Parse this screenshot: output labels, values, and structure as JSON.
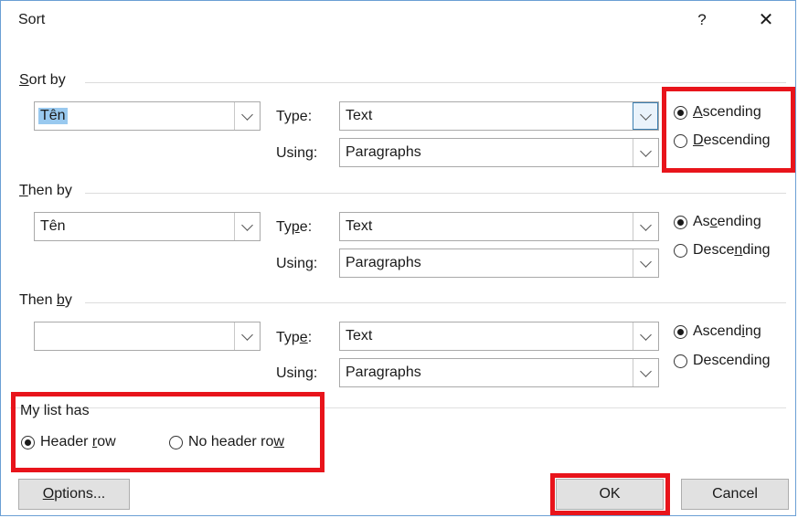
{
  "window": {
    "title": "Sort",
    "help": "?",
    "close": "✕"
  },
  "sort_by": {
    "label_pre": "",
    "label_u": "S",
    "label_post": "ort by",
    "field": "Tên",
    "type_label_pre": "Type:",
    "type": "Text",
    "using_label": "Using:",
    "using": "Paragraphs",
    "ascending_pre": "",
    "ascending_u": "A",
    "ascending_post": "scending",
    "descending_pre": "",
    "descending_u": "D",
    "descending_post": "escending"
  },
  "then_by_1": {
    "label_pre": "",
    "label_u": "T",
    "label_post": "hen by",
    "field": "Tên",
    "type_label_pre": "Ty",
    "type_label_u": "p",
    "type_label_post": "e:",
    "type": "Text",
    "using_label": "Using:",
    "using": "Paragraphs",
    "ascending_pre": "As",
    "ascending_u": "c",
    "ascending_post": "ending",
    "descending_pre": "Desce",
    "descending_u": "n",
    "descending_post": "ding"
  },
  "then_by_2": {
    "label_pre": "Then ",
    "label_u": "b",
    "label_post": "y",
    "field": "",
    "type_label_pre": "Typ",
    "type_label_u": "e",
    "type_label_post": ":",
    "type": "Text",
    "using_label": "Using:",
    "using": "Paragraphs",
    "ascending_pre": "Ascend",
    "ascending_u": "i",
    "ascending_post": "ng",
    "descending_pre": "Descendin",
    "descending_u": "g",
    "descending_post": ""
  },
  "my_list": {
    "label": "My list has",
    "header_pre": "Header ",
    "header_u": "r",
    "header_post": "ow",
    "noheader_pre": "No header ro",
    "noheader_u": "w",
    "noheader_post": ""
  },
  "buttons": {
    "options_pre": "",
    "options_u": "O",
    "options_post": "ptions...",
    "ok": "OK",
    "cancel": "Cancel"
  },
  "colors": {
    "highlight": "#e8141b",
    "selection": "#99c9ef",
    "border": "#6a9fd4"
  }
}
